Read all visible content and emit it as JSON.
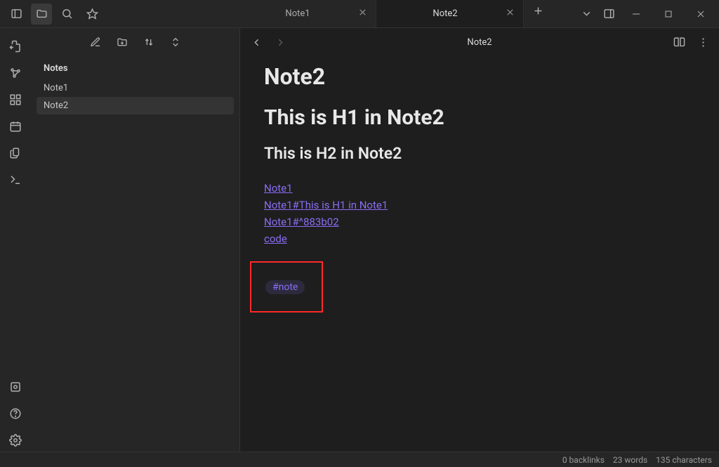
{
  "tabs": [
    {
      "title": "Note1"
    },
    {
      "title": "Note2"
    }
  ],
  "sidebar": {
    "section_title": "Notes",
    "items": [
      "Note1",
      "Note2"
    ]
  },
  "editor": {
    "header_title": "Note2",
    "note_title": "Note2",
    "h1": "This is H1 in Note2",
    "h2": "This is H2 in Note2",
    "links": [
      "Note1",
      "Note1#This is H1 in Note1",
      "Note1#^883b02",
      "code"
    ],
    "tag": "#note"
  },
  "statusbar": {
    "backlinks": "0 backlinks",
    "words": "23 words",
    "characters": "135 characters"
  }
}
